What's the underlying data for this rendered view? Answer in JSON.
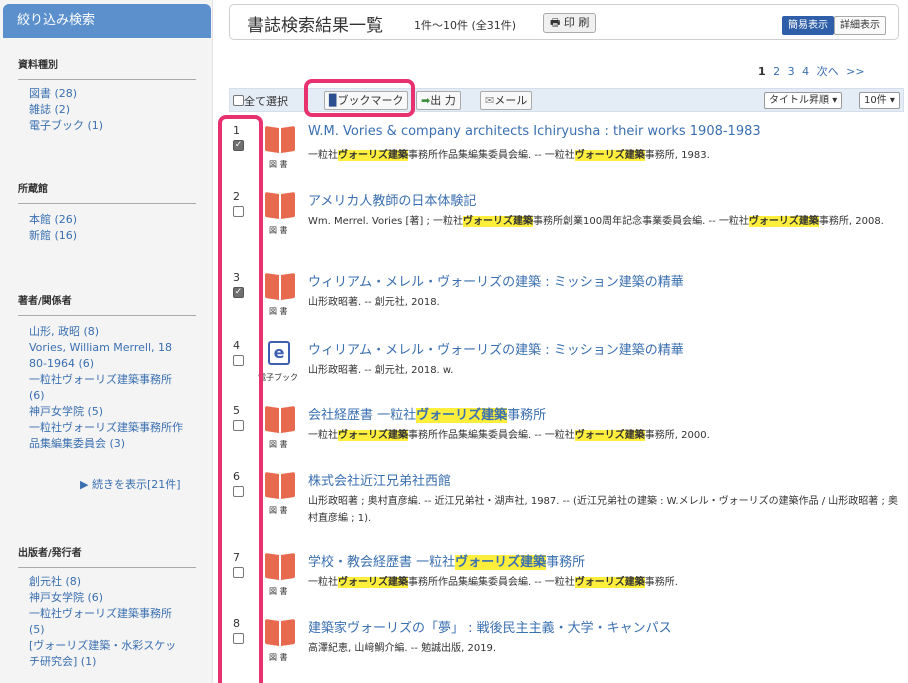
{
  "sidebar": {
    "header": "絞り込み検索",
    "sections": [
      {
        "title": "資料種別",
        "items": [
          "図書 (28)",
          "雑誌 (2)",
          "電子ブック (1)"
        ]
      },
      {
        "title": "所蔵館",
        "items": [
          "本館 (26)",
          "新館 (16)"
        ]
      },
      {
        "title": "著者/関係者",
        "items": [
          "山形, 政昭 (8)",
          "Vories, William Merrell, 18",
          "80-1964 (6)",
          "一粒社ヴォーリズ建築事務所",
          "(6)",
          "神戸女学院 (5)",
          "一粒社ヴォーリズ建築事務所作",
          "品集編集委員会 (3)"
        ],
        "more": "▶ 続きを表示[21件]"
      },
      {
        "title": "出版者/発行者",
        "items": [
          "創元社 (8)",
          "神戸女学院 (6)",
          "一粒社ヴォーリズ建築事務所",
          "(5)",
          "[ヴォーリズ建築・水彩スケッ",
          "チ研究会] (1)"
        ]
      }
    ]
  },
  "header": {
    "title": "書誌検索結果一覧",
    "count": "1件～10件 (全31件)",
    "print": "印 刷",
    "simple": "簡易表示",
    "detail": "詳細表示"
  },
  "pager": {
    "current": "1",
    "pages": [
      "2",
      "3",
      "4"
    ],
    "next": "次へ",
    "last": ">>"
  },
  "toolbar": {
    "select_all": "全て選択",
    "bookmark": "ブックマーク",
    "export": "出 力",
    "mail": "メール",
    "sort": "タイトル昇順",
    "per_page": "10件"
  },
  "results": [
    {
      "n": "1",
      "checked": true,
      "type": "図 書",
      "title": [
        [
          "W.M. Vories & company architects Ichiryusha : their works 1908-1983",
          0
        ]
      ],
      "desc": [
        [
          "一粒社",
          0
        ],
        [
          "ヴォーリズ建築",
          1
        ],
        [
          "事務所作品集編集委員会編. -- 一粒社",
          0
        ],
        [
          "ヴォーリズ建築",
          1
        ],
        [
          "事務所, 1983.",
          0
        ]
      ]
    },
    {
      "n": "2",
      "checked": false,
      "type": "図 書",
      "title": [
        [
          "アメリカ人教師の日本体験記",
          0
        ]
      ],
      "desc": [
        [
          "Wm. Merrel. Vories [著] ; 一粒社",
          0
        ],
        [
          "ヴォーリズ建築",
          1
        ],
        [
          "事務所創業100周年記念事業委員会編. -- 一粒社",
          0
        ],
        [
          "ヴォーリズ建築",
          1
        ],
        [
          "事務所, 2008.",
          0
        ]
      ]
    },
    {
      "n": "3",
      "checked": true,
      "type": "図 書",
      "title": [
        [
          "ウィリアム・メレル・ヴォーリズの建築 : ミッション建築の精華",
          0
        ]
      ],
      "desc": [
        [
          "山形政昭著. -- 創元社, 2018.",
          0
        ]
      ]
    },
    {
      "n": "4",
      "checked": false,
      "type": "電子ブック",
      "ebook": true,
      "title": [
        [
          "ウィリアム・メレル・ヴォーリズの建築 : ミッション建築の精華",
          0
        ]
      ],
      "desc": [
        [
          "山形政昭著. -- 創元社, 2018. w.",
          0
        ]
      ]
    },
    {
      "n": "5",
      "checked": false,
      "type": "図 書",
      "title": [
        [
          "会社経歴書 一粒社",
          0
        ],
        [
          "ヴォーリズ建築",
          1
        ],
        [
          "事務所",
          0
        ]
      ],
      "desc": [
        [
          "一粒社",
          0
        ],
        [
          "ヴォーリズ建築",
          1
        ],
        [
          "事務所作品集編集委員会編. -- 一粒社",
          0
        ],
        [
          "ヴォーリズ建築",
          1
        ],
        [
          "事務所, 2000.",
          0
        ]
      ]
    },
    {
      "n": "6",
      "checked": false,
      "type": "図 書",
      "title": [
        [
          "株式会社近江兄弟社西館",
          0
        ]
      ],
      "desc": [
        [
          "山形政昭著 ; 奥村直彦編. -- 近江兄弟社・湖声社, 1987. -- (近江兄弟社の建築 : W.メレル・ヴォーリズの建築作品 / 山形政昭著 ; 奥村直彦編 ; 1).",
          0
        ]
      ]
    },
    {
      "n": "7",
      "checked": false,
      "type": "図 書",
      "title": [
        [
          "学校・教会経歴書 一粒社",
          0
        ],
        [
          "ヴォーリズ建築",
          1
        ],
        [
          "事務所",
          0
        ]
      ],
      "desc": [
        [
          "一粒社",
          0
        ],
        [
          "ヴォーリズ建築",
          1
        ],
        [
          "事務所作品集編集委員会編. -- 一粒社",
          0
        ],
        [
          "ヴォーリズ建築",
          1
        ],
        [
          "事務所.",
          0
        ]
      ]
    },
    {
      "n": "8",
      "checked": false,
      "type": "図 書",
      "title": [
        [
          "建築家ヴォーリズの「夢」 : 戦後民主主義・大学・キャンパス",
          0
        ]
      ],
      "desc": [
        [
          "高澤紀恵, 山﨑鯛介編. -- 勉誠出版, 2019.",
          0
        ]
      ]
    }
  ]
}
